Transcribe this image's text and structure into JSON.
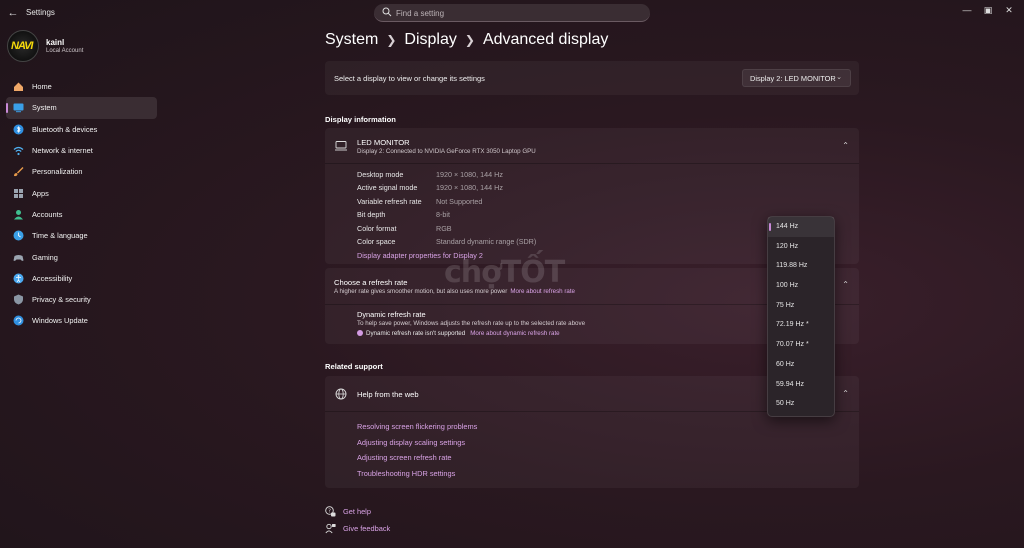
{
  "app": {
    "title": "Settings",
    "search_placeholder": "Find a setting"
  },
  "user": {
    "name": "kainl",
    "account_type": "Local Account",
    "avatar_text": "NAVI"
  },
  "sidebar": {
    "items": [
      {
        "label": "Home",
        "icon": "home-icon",
        "color": "#f0a868"
      },
      {
        "label": "System",
        "icon": "system-icon",
        "color": "#3aa0e8",
        "active": true
      },
      {
        "label": "Bluetooth & devices",
        "icon": "bluetooth-icon",
        "color": "#2f8fe0"
      },
      {
        "label": "Network & internet",
        "icon": "network-icon",
        "color": "#4fb0f0"
      },
      {
        "label": "Personalization",
        "icon": "brush-icon",
        "color": "#e89a4a"
      },
      {
        "label": "Apps",
        "icon": "apps-icon",
        "color": "#9aa4b0"
      },
      {
        "label": "Accounts",
        "icon": "accounts-icon",
        "color": "#3fbf8f"
      },
      {
        "label": "Time & language",
        "icon": "time-language-icon",
        "color": "#3aa0e8"
      },
      {
        "label": "Gaming",
        "icon": "gaming-icon",
        "color": "#9aa4b0"
      },
      {
        "label": "Accessibility",
        "icon": "accessibility-icon",
        "color": "#4aa8f0"
      },
      {
        "label": "Privacy & security",
        "icon": "shield-icon",
        "color": "#8a96a4"
      },
      {
        "label": "Windows Update",
        "icon": "update-icon",
        "color": "#2f8fe0"
      }
    ]
  },
  "breadcrumb": [
    "System",
    "Display",
    "Advanced display"
  ],
  "display_select": {
    "label": "Select a display to view or change its settings",
    "value": "Display 2: LED MONITOR"
  },
  "display_info": {
    "section_title": "Display information",
    "monitor_name": "LED MONITOR",
    "monitor_sub": "Display 2: Connected to NVIDIA GeForce RTX 3050 Laptop GPU",
    "rows": [
      {
        "key": "Desktop mode",
        "value": "1920 × 1080, 144 Hz"
      },
      {
        "key": "Active signal mode",
        "value": "1920 × 1080, 144 Hz"
      },
      {
        "key": "Variable refresh rate",
        "value": "Not Supported"
      },
      {
        "key": "Bit depth",
        "value": "8-bit"
      },
      {
        "key": "Color format",
        "value": "RGB"
      },
      {
        "key": "Color space",
        "value": "Standard dynamic range (SDR)"
      }
    ],
    "adapter_link": "Display adapter properties for Display 2"
  },
  "refresh": {
    "title": "Choose a refresh rate",
    "description": "A higher rate gives smoother motion, but also uses more power",
    "more_link": "More about refresh rate",
    "dynamic_title": "Dynamic refresh rate",
    "dynamic_desc": "To help save power, Windows adjusts the refresh rate up to the selected rate above",
    "dynamic_warning": "Dynamic refresh rate isn't supported",
    "dynamic_link": "More about dynamic refresh rate",
    "options": [
      "144 Hz",
      "120 Hz",
      "119.88 Hz",
      "100 Hz",
      "75 Hz",
      "72.19 Hz *",
      "70.07 Hz *",
      "60 Hz",
      "59.94 Hz",
      "50 Hz"
    ],
    "selected": "144 Hz"
  },
  "related": {
    "section_title": "Related support",
    "help_title": "Help from the web",
    "links": [
      "Resolving screen flickering problems",
      "Adjusting display scaling settings",
      "Adjusting screen refresh rate",
      "Troubleshooting HDR settings"
    ]
  },
  "footer": {
    "get_help": "Get help",
    "give_feedback": "Give feedback"
  },
  "watermark": "chợTỐT"
}
